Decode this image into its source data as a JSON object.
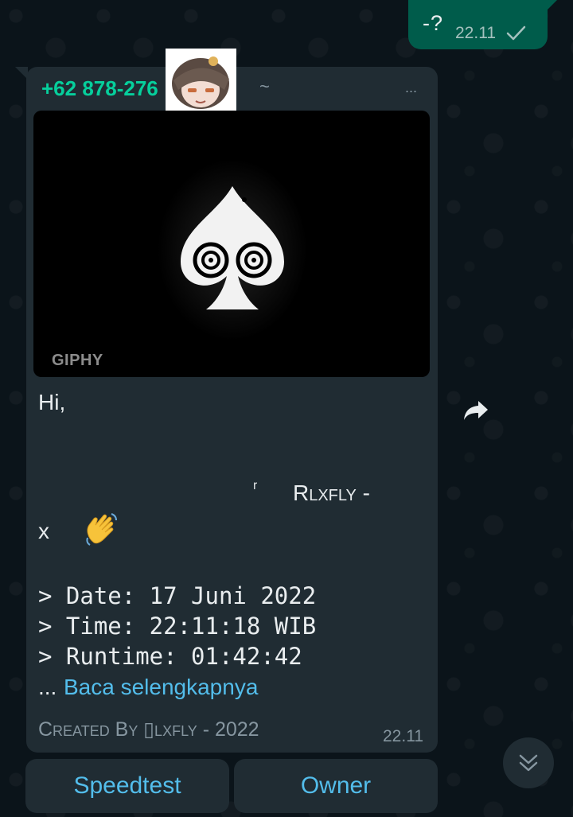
{
  "outgoing": {
    "text": "-?",
    "time": "22.11",
    "status_icon": "single-check-icon"
  },
  "incoming": {
    "sender": "+62 878-276",
    "tilde": "~",
    "menu": "...",
    "media": {
      "watermark": "GIPHY",
      "icon": "spade-swirl-gif"
    },
    "greeting": "Hi,",
    "name_prefix": "ʳ",
    "name_main": "Rlxfly -",
    "name_suffix": "x",
    "wave_icon": "waving-hand-emoji",
    "line_date": "> Date: 17 Juni 2022",
    "line_time": "> Time: 22:11:18 WIB",
    "line_runtime": "> Runtime: 01:42:42",
    "ellipsis": "...",
    "read_more": "Baca selengkapnya",
    "footer": "Created By ▯lxfly - 2022",
    "time": "22.11"
  },
  "buttons": {
    "speedtest": "Speedtest",
    "owner": "Owner"
  },
  "icons": {
    "forward": "forward-arrow-icon",
    "scroll_down": "double-chevron-down-icon"
  },
  "colors": {
    "background": "#0b141a",
    "bubble_in": "#202c33",
    "bubble_out": "#005c4b",
    "sender": "#06cf9c",
    "link": "#53bdeb",
    "meta": "#8696a0"
  }
}
